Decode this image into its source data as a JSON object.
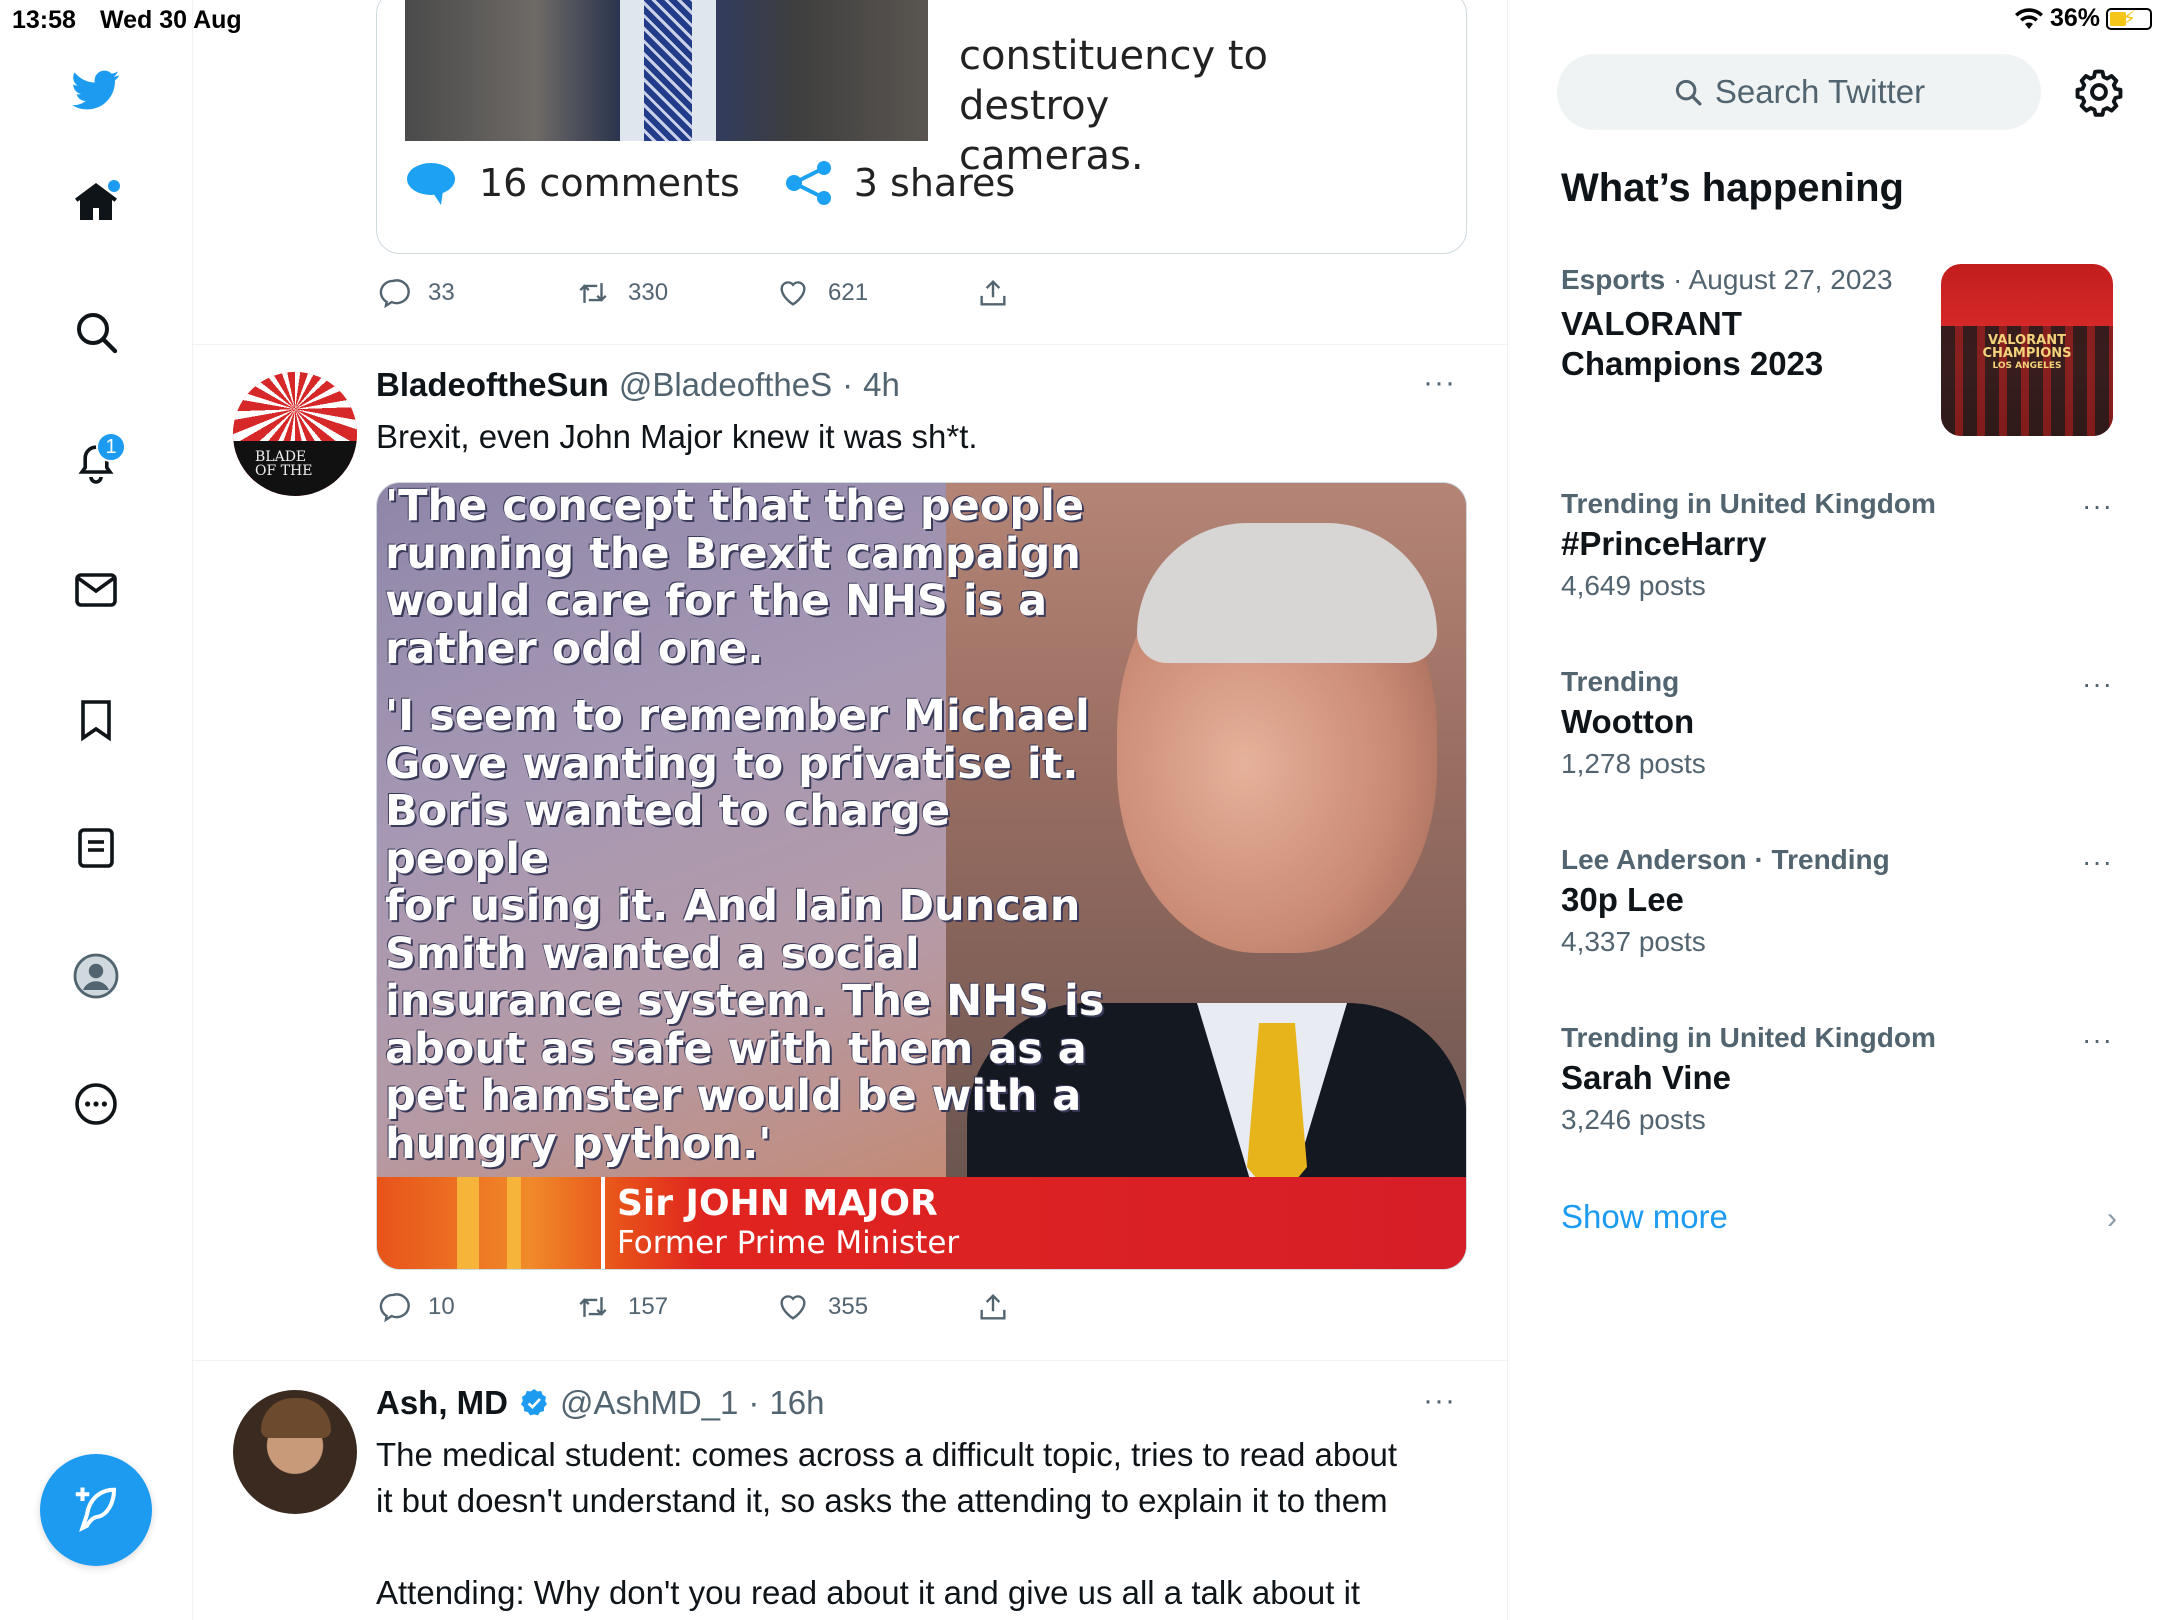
{
  "status_bar": {
    "time": "13:58",
    "date": "Wed 30 Aug",
    "battery": "36%"
  },
  "left_nav": {
    "notifications_badge": "1",
    "items": [
      "twitter-logo",
      "home-icon",
      "search-icon",
      "bell-icon",
      "mail-icon",
      "bookmark-icon",
      "lists-icon",
      "profile-icon",
      "more-icon"
    ]
  },
  "timeline": {
    "card_top": {
      "text_line1": "constituency to destroy",
      "text_line2": "cameras.",
      "comments": "16 comments",
      "shares": "3 shares"
    },
    "tweet0_actions": {
      "replies": "33",
      "retweets": "330",
      "likes": "621"
    },
    "tweet1": {
      "name": "BladeoftheSun",
      "handle": "@BladeoftheS",
      "time": "4h",
      "separator": "·",
      "text": "Brexit, even John Major knew it was sh*t.",
      "avatar_label_1": "BLADE",
      "avatar_label_2": "OF THE",
      "image": {
        "quote_p1_l1": "'The concept that the people",
        "quote_p1_l2": "running the Brexit campaign",
        "quote_p1_l3": "would care for the NHS is a",
        "quote_p1_l4": "rather odd one.",
        "quote_p2_l1": "'I seem to remember Michael",
        "quote_p2_l2": "Gove wanting to privatise it.",
        "quote_p2_l3": "Boris wanted to charge people",
        "quote_p2_l4": "for using it. And Iain Duncan",
        "quote_p2_l5": "Smith wanted a social",
        "quote_p2_l6": "insurance system. The NHS is",
        "quote_p2_l7": "about as safe with them as a",
        "quote_p2_l8": "pet hamster would be with a",
        "quote_p2_l9": "hungry python.'",
        "caption_name": "Sir JOHN MAJOR",
        "caption_role": "Former Prime Minister"
      },
      "actions": {
        "replies": "10",
        "retweets": "157",
        "likes": "355"
      }
    },
    "tweet2": {
      "name": "Ash, MD",
      "handle": "@AshMD_1",
      "time": "16h",
      "separator": "·",
      "text_line1": "The medical student: comes across a difficult topic,  tries to read about",
      "text_line2": "it but doesn't understand it, so asks the attending to explain it to them",
      "text_line3": "Attending: Why don't you read about it and give us all a talk about it"
    }
  },
  "sidebar": {
    "search_placeholder": "Search Twitter",
    "whats_happening": "What’s happening",
    "trends": [
      {
        "category": "Esports",
        "meta": "· August 27, 2023",
        "title_l1": "VALORANT",
        "title_l2": "Champions 2023",
        "image_label_1": "VALORANT",
        "image_label_2": "CHAMPIONS",
        "image_label_3": "LOS ANGELES"
      },
      {
        "category": "Trending in United Kingdom",
        "title": "#PrinceHarry",
        "count": "4,649 posts"
      },
      {
        "category": "Trending",
        "title": "Wootton",
        "count": "1,278 posts"
      },
      {
        "category": "Lee Anderson · Trending",
        "title": "30p Lee",
        "count": "4,337 posts"
      },
      {
        "category": "Trending in United Kingdom",
        "title": "Sarah Vine",
        "count": "3,246 posts"
      }
    ],
    "show_more": "Show more"
  },
  "colors": {
    "accent": "#1d9bf0",
    "text_primary": "#0f1419",
    "text_secondary": "#536471",
    "divider": "#eff3f4"
  }
}
